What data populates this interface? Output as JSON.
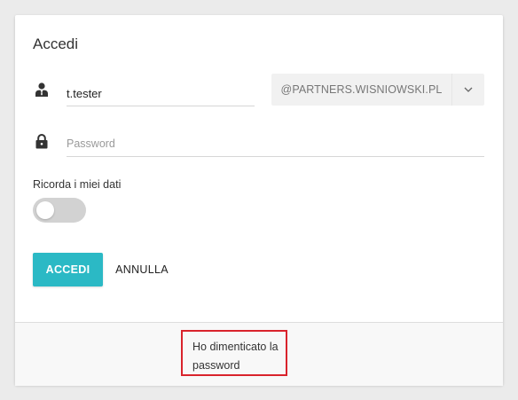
{
  "login": {
    "title": "Accedi",
    "username_value": "t.tester",
    "domain": "@PARTNERS.WISNIOWSKI.PL",
    "password_placeholder": "Password",
    "remember_label": "Ricorda i miei dati",
    "remember_checked": false,
    "accedi_label": "ACCEDI",
    "annulla_label": "ANNULLA",
    "forgot_label": "Ho dimenticato la password"
  },
  "colors": {
    "accent": "#2bb9c5",
    "highlight_border": "#d9232c"
  },
  "icons": {
    "user": "user-tie-icon",
    "lock": "lock-icon",
    "chevron": "chevron-down-icon"
  }
}
